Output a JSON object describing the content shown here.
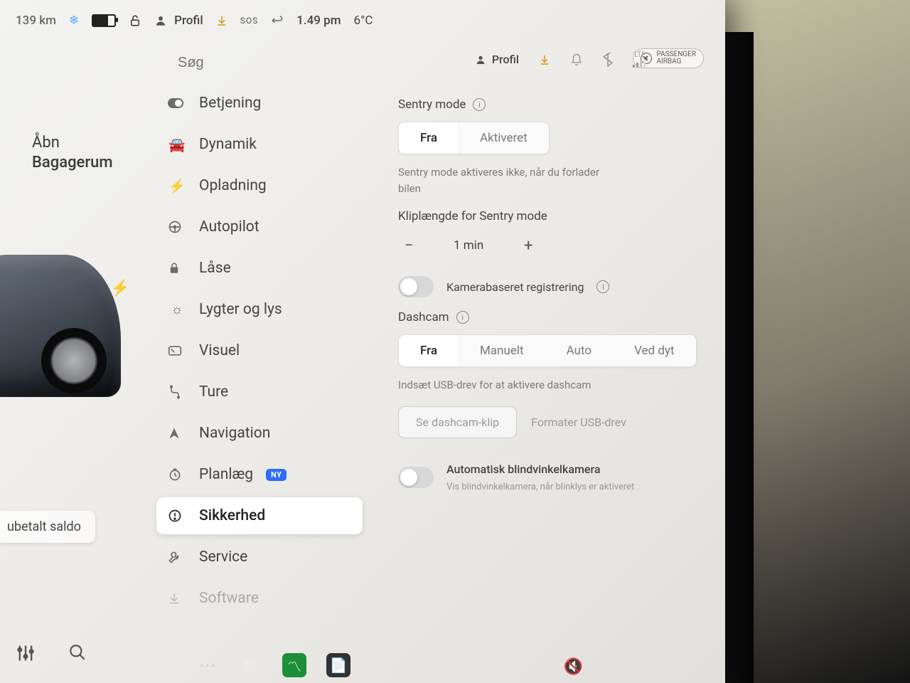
{
  "status": {
    "range": "139 km",
    "profile": "Profil",
    "sos": "SOS",
    "time": "1.49 pm",
    "temp": "6°C",
    "airbag_line1": "PASSENGER",
    "airbag_line2": "AIRBAG"
  },
  "car_panel": {
    "open_line1": "Åbn",
    "open_line2": "Bagagerum",
    "paid_balance": "ubetalt saldo"
  },
  "search": {
    "placeholder": "Søg"
  },
  "sidebar": {
    "items": [
      {
        "label": "Betjening"
      },
      {
        "label": "Dynamik"
      },
      {
        "label": "Opladning"
      },
      {
        "label": "Autopilot"
      },
      {
        "label": "Låse"
      },
      {
        "label": "Lygter og lys"
      },
      {
        "label": "Visuel"
      },
      {
        "label": "Ture"
      },
      {
        "label": "Navigation"
      },
      {
        "label": "Planlæg",
        "badge": "NY"
      },
      {
        "label": "Sikkerhed"
      },
      {
        "label": "Service"
      },
      {
        "label": "Software"
      }
    ]
  },
  "content": {
    "profile": "Profil",
    "sentry": {
      "title": "Sentry mode",
      "off": "Fra",
      "on": "Aktiveret",
      "desc": "Sentry mode aktiveres ikke, når du forlader bilen"
    },
    "clip": {
      "title": "Kliplængde for Sentry mode",
      "value": "1 min"
    },
    "camera_detect": "Kamerabaseret registrering",
    "dashcam": {
      "title": "Dashcam",
      "opts": [
        "Fra",
        "Manuelt",
        "Auto",
        "Ved dyt"
      ],
      "desc": "Indsæt USB-drev for at aktivere dashcam",
      "view": "Se dashcam-klip",
      "format": "Formater USB-drev"
    },
    "blindspot": {
      "title": "Automatisk blindvinkelkamera",
      "desc": "Vis blindvinkelkamera, når blinklys er aktiveret"
    }
  }
}
